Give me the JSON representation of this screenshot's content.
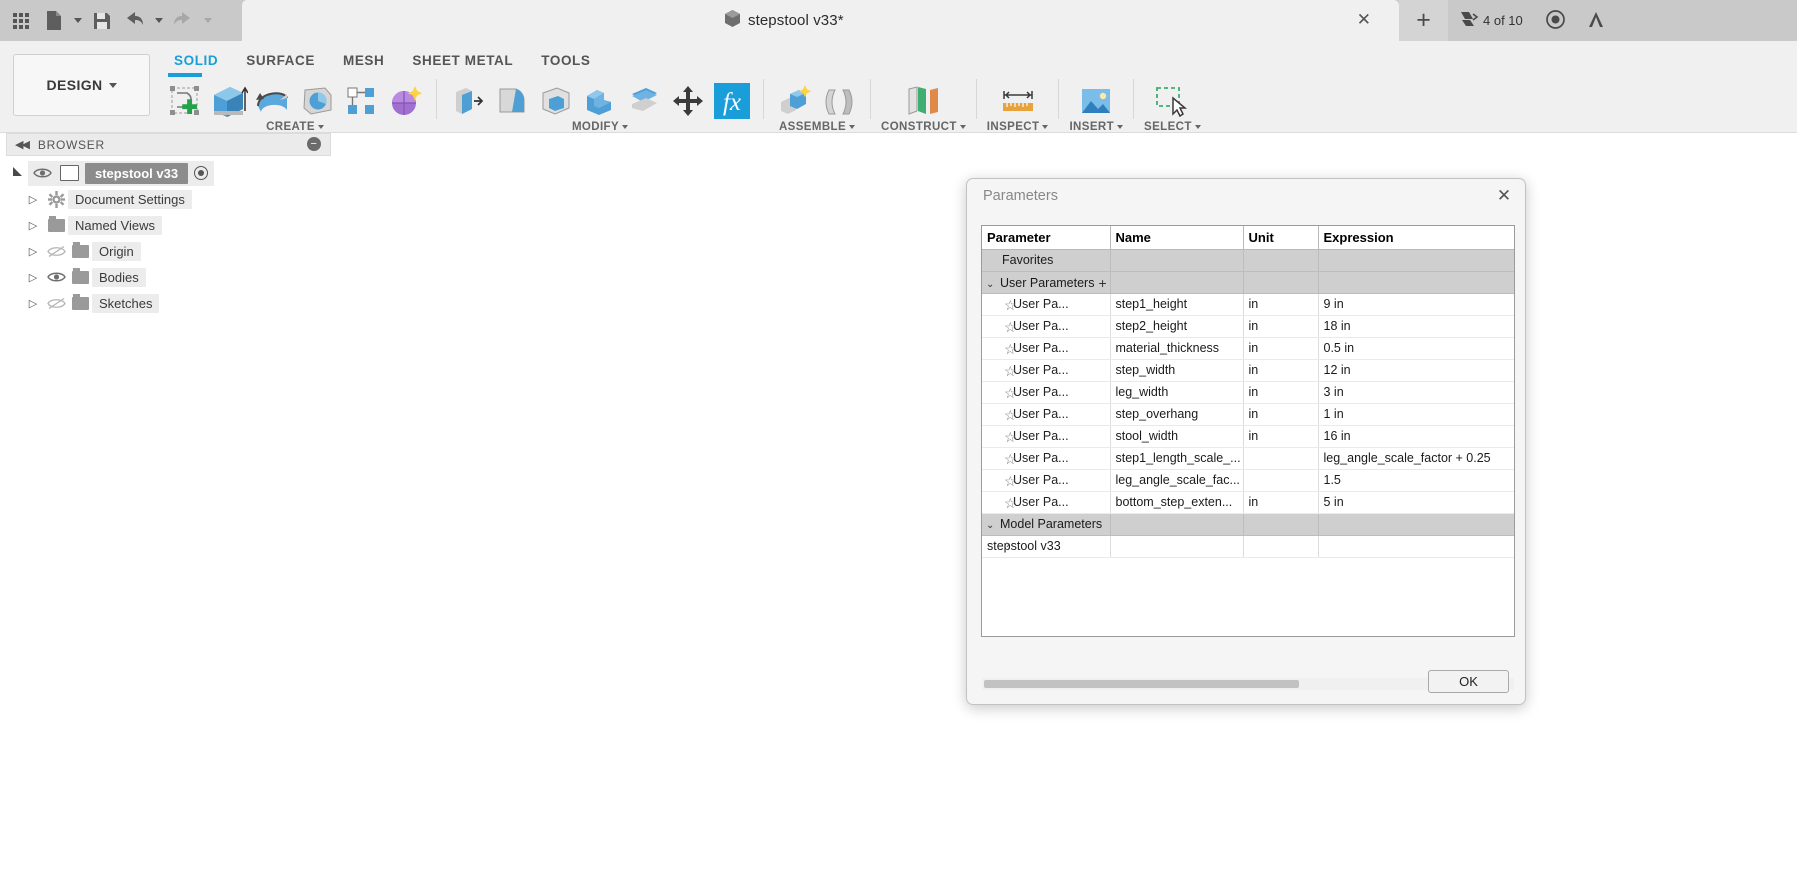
{
  "app": {
    "name": "Autodesk Fusion 360"
  },
  "titlebar": {
    "quick_access": [
      {
        "name": "app-grid",
        "icon": "grid-icon",
        "label": ""
      },
      {
        "name": "new-document",
        "icon": "file-icon",
        "label": ""
      },
      {
        "name": "save",
        "icon": "save-icon",
        "label": ""
      },
      {
        "name": "undo",
        "icon": "undo-icon",
        "label": ""
      },
      {
        "name": "redo",
        "icon": "redo-icon",
        "label": ""
      }
    ],
    "document_tab": {
      "title": "stepstool v33*",
      "close_label": "✕",
      "icon": "cube-icon"
    },
    "new_tab_label": "+",
    "job_status": {
      "label": "4 of 10",
      "icon": "job-status-icon"
    },
    "history_icon": "clock-icon",
    "account_icon": "account-icon"
  },
  "ribbon": {
    "workspace": {
      "label": "DESIGN",
      "caret": "▾"
    },
    "tabs": [
      {
        "label": "SOLID",
        "active": true
      },
      {
        "label": "SURFACE",
        "active": false
      },
      {
        "label": "MESH",
        "active": false
      },
      {
        "label": "SHEET METAL",
        "active": false
      },
      {
        "label": "TOOLS",
        "active": false
      }
    ],
    "panels": [
      {
        "label": "CREATE",
        "caret": "▾",
        "tools": [
          {
            "name": "create-sketch-icon",
            "label": "Create Sketch"
          },
          {
            "name": "extrude-icon",
            "label": "Extrude"
          },
          {
            "name": "revolve-icon",
            "label": "Revolve"
          },
          {
            "name": "sweep-icon",
            "label": "Sweep"
          },
          {
            "name": "pattern-icon",
            "label": "Pattern"
          },
          {
            "name": "create-form-icon",
            "label": "Create Form"
          }
        ]
      },
      {
        "label": "MODIFY",
        "caret": "▾",
        "tools": [
          {
            "name": "press-pull-icon",
            "label": "Press Pull"
          },
          {
            "name": "fillet-icon",
            "label": "Fillet"
          },
          {
            "name": "shell-icon",
            "label": "Shell"
          },
          {
            "name": "combine-icon",
            "label": "Combine"
          },
          {
            "name": "split-face-icon",
            "label": "Split Face"
          },
          {
            "name": "move-copy-icon",
            "label": "Move/Copy"
          },
          {
            "name": "change-parameters-icon",
            "label": "fx"
          }
        ]
      },
      {
        "label": "ASSEMBLE",
        "caret": "▾",
        "tools": [
          {
            "name": "new-component-icon",
            "label": "New Component"
          },
          {
            "name": "joint-icon",
            "label": "Joint"
          }
        ]
      },
      {
        "label": "CONSTRUCT",
        "caret": "▾",
        "tools": [
          {
            "name": "offset-plane-icon",
            "label": "Offset Plane"
          }
        ]
      },
      {
        "label": "INSPECT",
        "caret": "▾",
        "tools": [
          {
            "name": "measure-icon",
            "label": "Measure"
          }
        ]
      },
      {
        "label": "INSERT",
        "caret": "▾",
        "tools": [
          {
            "name": "insert-image-icon",
            "label": "Canvas"
          }
        ]
      },
      {
        "label": "SELECT",
        "caret": "▾",
        "tools": [
          {
            "name": "select-window-icon",
            "label": "Select"
          }
        ]
      }
    ]
  },
  "browser": {
    "title": "BROWSER",
    "collapse_icon": "double-arrow-left-icon",
    "options_icon": "minus-circle-icon",
    "root": {
      "label": "stepstool v33",
      "visible": true,
      "icon": "component-cube-icon",
      "activate_icon": "radio-selected-icon"
    },
    "items": [
      {
        "label": "Document Settings",
        "icon": "gear-icon",
        "has_eye": false,
        "visible": true
      },
      {
        "label": "Named Views",
        "icon": "folder-icon",
        "has_eye": false,
        "visible": true
      },
      {
        "label": "Origin",
        "icon": "folder-icon",
        "has_eye": true,
        "visible": false
      },
      {
        "label": "Bodies",
        "icon": "folder-icon",
        "has_eye": true,
        "visible": true
      },
      {
        "label": "Sketches",
        "icon": "folder-icon",
        "has_eye": true,
        "visible": false
      }
    ]
  },
  "dialog": {
    "title": "Parameters",
    "close_label": "✕",
    "ok_label": "OK",
    "columns": [
      "Parameter",
      "Name",
      "Unit",
      "Expression"
    ],
    "groups": [
      {
        "type": "group",
        "label": "Favorites",
        "expandable": false,
        "add": false
      },
      {
        "type": "group",
        "label": "User Parameters",
        "expandable": true,
        "expanded": true,
        "toggle": "⌄",
        "add": true,
        "add_label": "+"
      }
    ],
    "rows": [
      {
        "parameter": "User Pa...",
        "name": "step1_height",
        "unit": "in",
        "expression": "9 in",
        "favorite": false
      },
      {
        "parameter": "User Pa...",
        "name": "step2_height",
        "unit": "in",
        "expression": "18 in",
        "favorite": false
      },
      {
        "parameter": "User Pa...",
        "name": "material_thickness",
        "unit": "in",
        "expression": "0.5 in",
        "favorite": false
      },
      {
        "parameter": "User Pa...",
        "name": "step_width",
        "unit": "in",
        "expression": "12 in",
        "favorite": false
      },
      {
        "parameter": "User Pa...",
        "name": "leg_width",
        "unit": "in",
        "expression": "3 in",
        "favorite": false
      },
      {
        "parameter": "User Pa...",
        "name": "step_overhang",
        "unit": "in",
        "expression": "1 in",
        "favorite": false
      },
      {
        "parameter": "User Pa...",
        "name": "stool_width",
        "unit": "in",
        "expression": "16 in",
        "favorite": false
      },
      {
        "parameter": "User Pa...",
        "name": "step1_length_scale_...",
        "unit": "",
        "expression": "leg_angle_scale_factor + 0.25",
        "favorite": false
      },
      {
        "parameter": "User Pa...",
        "name": "leg_angle_scale_fac...",
        "unit": "",
        "expression": "1.5",
        "favorite": false
      },
      {
        "parameter": "User Pa...",
        "name": "bottom_step_exten...",
        "unit": "in",
        "expression": "5 in",
        "favorite": false
      }
    ],
    "model_group": {
      "label": "Model Parameters",
      "toggle": "⌄",
      "expanded": true
    },
    "model_rows": [
      {
        "label": "stepstool v33",
        "toggle": "›"
      }
    ]
  },
  "colors": {
    "accent": "#1a9ed9",
    "wood_blue": "#2b4a80",
    "wood_blue_dark": "#1d3660",
    "leg_gray": "#c6c4bd",
    "stripe": "#b9b5a8",
    "titlebar": "#c9c9c9",
    "ribbon": "#f0f0f0"
  }
}
